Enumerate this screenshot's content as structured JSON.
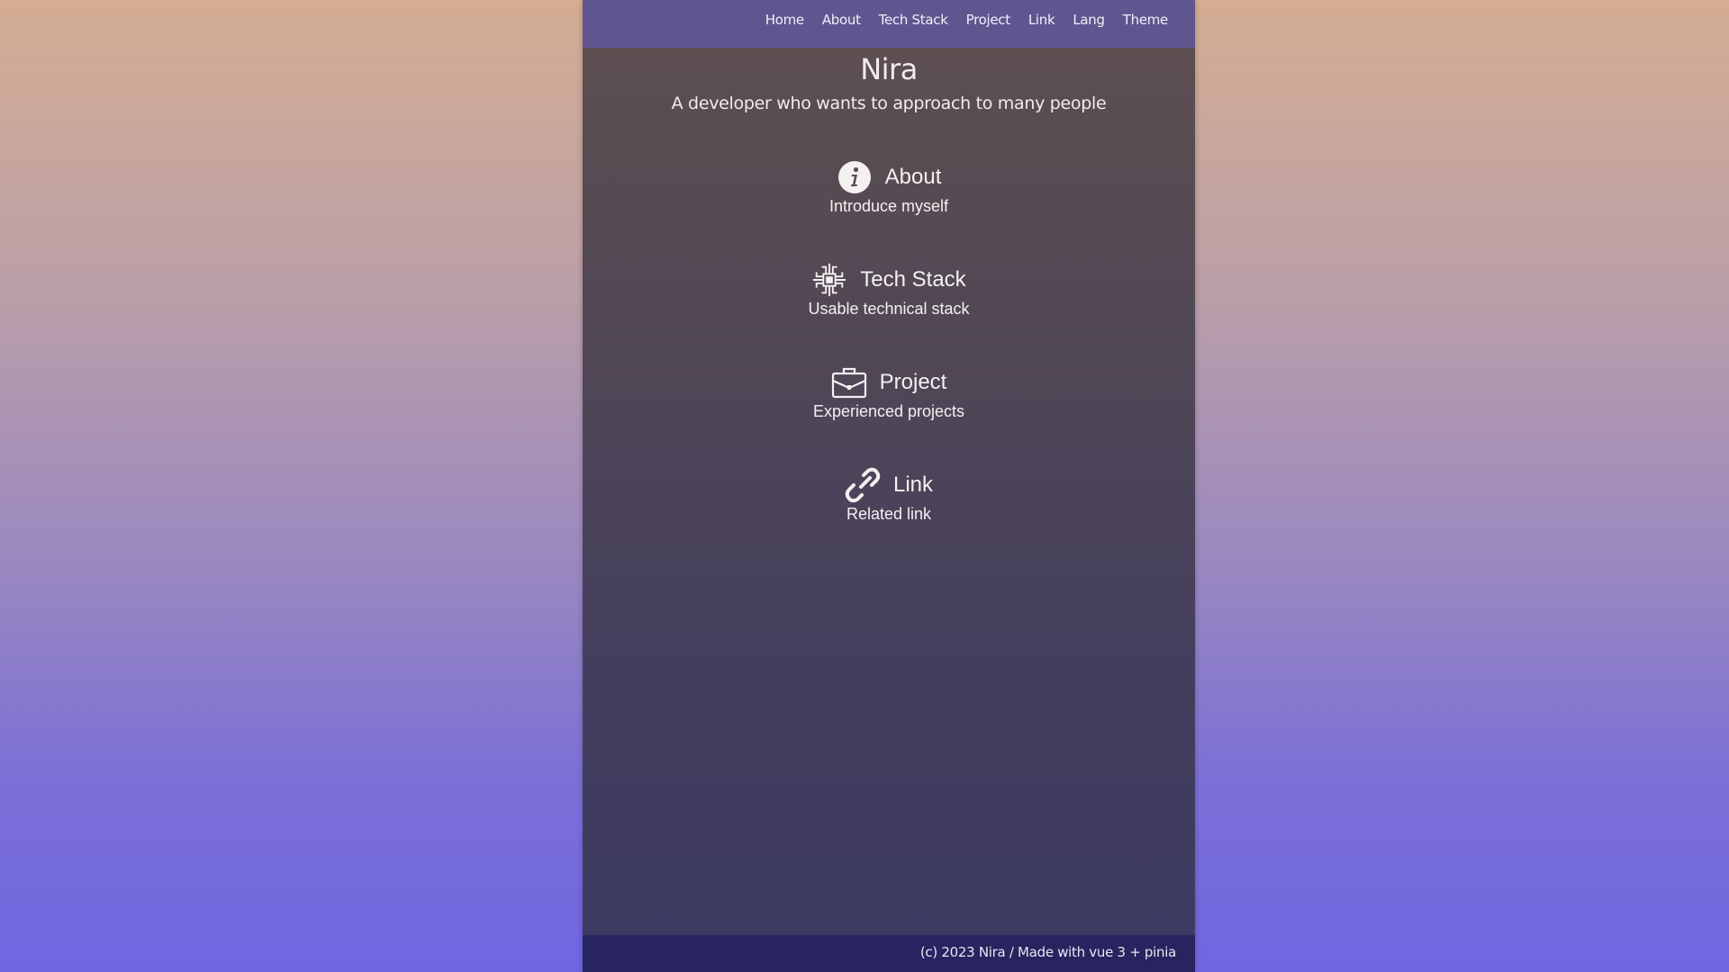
{
  "nav": {
    "items": [
      "Home",
      "About",
      "Tech Stack",
      "Project",
      "Link",
      "Lang",
      "Theme"
    ]
  },
  "hero": {
    "title": "Nira",
    "subtitle": "A developer who wants to approach to many people"
  },
  "menu": {
    "items": [
      {
        "icon": "info-circle-icon",
        "label": "About",
        "description": "Introduce myself"
      },
      {
        "icon": "cpu-chip-icon",
        "label": "Tech Stack",
        "description": "Usable technical stack"
      },
      {
        "icon": "briefcase-icon",
        "label": "Project",
        "description": "Experienced projects"
      },
      {
        "icon": "link-chain-icon",
        "label": "Link",
        "description": "Related link"
      }
    ]
  },
  "footer": {
    "text": "(c) 2023 Nira / Made with vue 3 + pinia"
  },
  "colors": {
    "navbar": "#5f5690",
    "footer": "#28245f",
    "text": "#f1ecec"
  }
}
